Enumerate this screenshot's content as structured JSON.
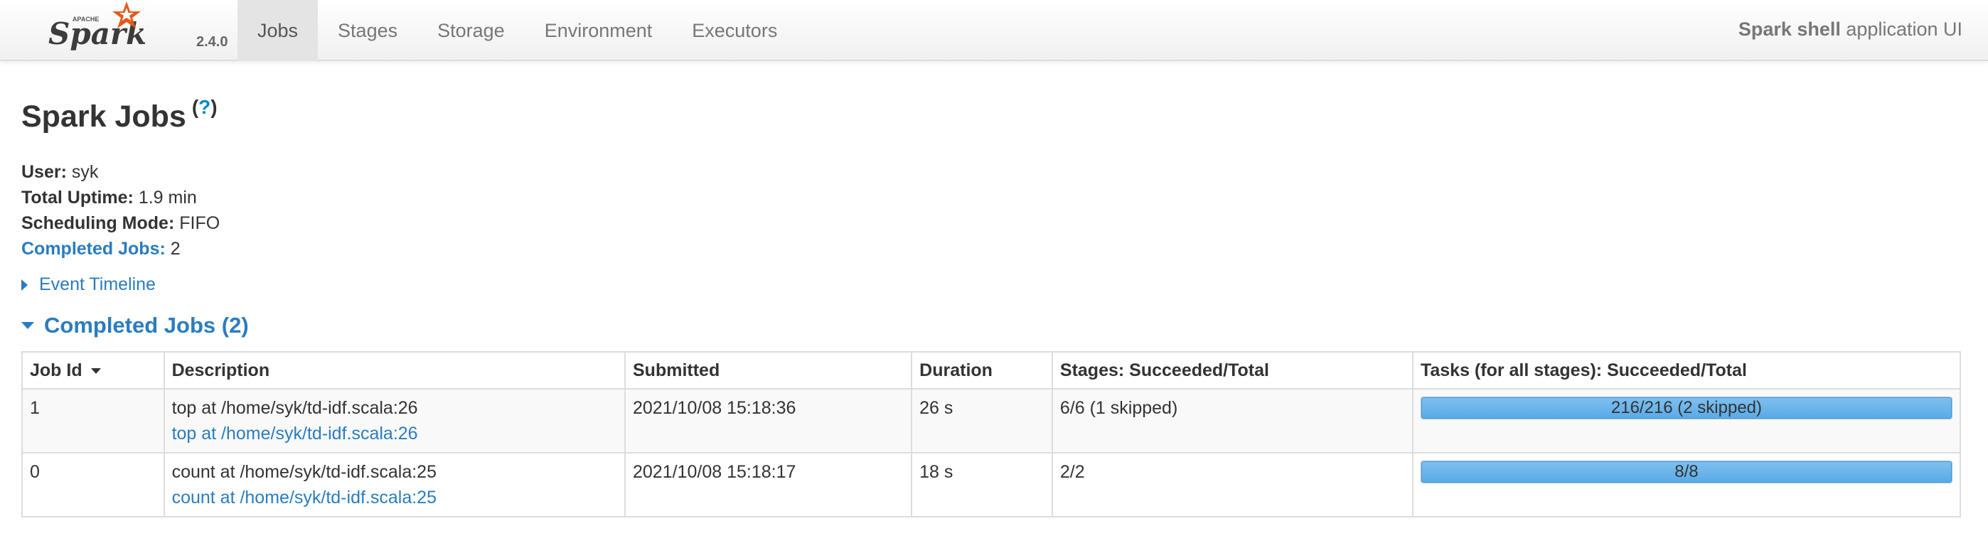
{
  "navbar": {
    "logo_apache": "APACHE",
    "logo_text": "Spark",
    "version": "2.4.0",
    "tabs": [
      {
        "label": "Jobs",
        "active": true
      },
      {
        "label": "Stages",
        "active": false
      },
      {
        "label": "Storage",
        "active": false
      },
      {
        "label": "Environment",
        "active": false
      },
      {
        "label": "Executors",
        "active": false
      }
    ],
    "app_name": "Spark shell",
    "app_suffix": " application UI"
  },
  "page": {
    "title": "Spark Jobs",
    "help_open": "(",
    "help_mark": "?",
    "help_close": ")"
  },
  "summary": {
    "user_label": "User:",
    "user_value": " syk",
    "uptime_label": "Total Uptime:",
    "uptime_value": " 1.9 min",
    "scheduling_label": "Scheduling Mode:",
    "scheduling_value": " FIFO",
    "completed_label": "Completed Jobs:",
    "completed_value": " 2"
  },
  "event_timeline": "Event Timeline",
  "completed_section": {
    "title": "Completed Jobs (2)",
    "columns": [
      "Job Id",
      "Description",
      "Submitted",
      "Duration",
      "Stages: Succeeded/Total",
      "Tasks (for all stages): Succeeded/Total"
    ],
    "rows": [
      {
        "job_id": "1",
        "description": "top at /home/syk/td-idf.scala:26",
        "description_link": "top at /home/syk/td-idf.scala:26",
        "submitted": "2021/10/08 15:18:36",
        "duration": "26 s",
        "stages": "6/6 (1 skipped)",
        "tasks_label": "216/216 (2 skipped)",
        "tasks_fraction": 1.0
      },
      {
        "job_id": "0",
        "description": "count at /home/syk/td-idf.scala:25",
        "description_link": "count at /home/syk/td-idf.scala:25",
        "submitted": "2021/10/08 15:18:17",
        "duration": "18 s",
        "stages": "2/2",
        "tasks_label": "8/8",
        "tasks_fraction": 1.0
      }
    ]
  },
  "colors": {
    "link": "#2a7cc0",
    "logo_orange": "#e25a1c",
    "progress_fill": "#5aaae8"
  }
}
